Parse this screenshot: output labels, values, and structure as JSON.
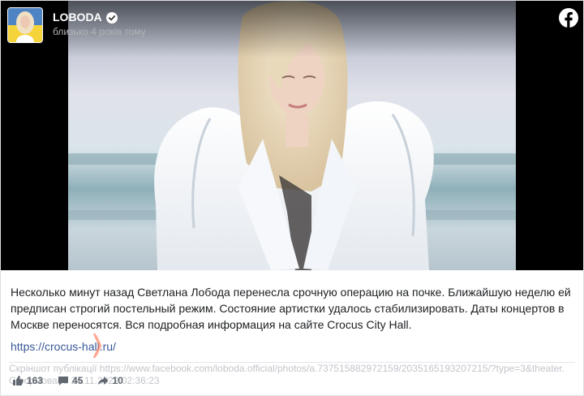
{
  "header": {
    "page_name": "LOBODA",
    "timestamp": "близько 4 років тому"
  },
  "icons": {
    "verified": "verified-badge-icon",
    "brand": "facebook-icon",
    "like": "thumbs-up-icon",
    "comment": "comment-icon",
    "share": "share-icon"
  },
  "post": {
    "text": "Несколько минут назад Светлана Лобода перенесла срочную операцию на почке. Ближайшую неделю ей предписан строгий постельный режим. Состояние артистки удалось стабилизировать. Даты концертов в Москве переносятся. Вся подробная информация на сайте Crocus City Hall.",
    "link": "https://crocus-hall.ru/"
  },
  "caption": {
    "source_line": "Скріншот публікації https://www.facebook.com/loboda.official/photos/a.737515882972159/2035165193207215/?type=3&theater.",
    "generated_line": "Сформовано 24.11.2022 02:36:23"
  },
  "stats": {
    "likes": "163",
    "comments": "45",
    "shares": "10"
  },
  "colors": {
    "link": "#385898",
    "text": "#1c1e21",
    "muted": "#c2c5ca",
    "media_background": "#000000",
    "cursor": "#ff7a5c"
  }
}
